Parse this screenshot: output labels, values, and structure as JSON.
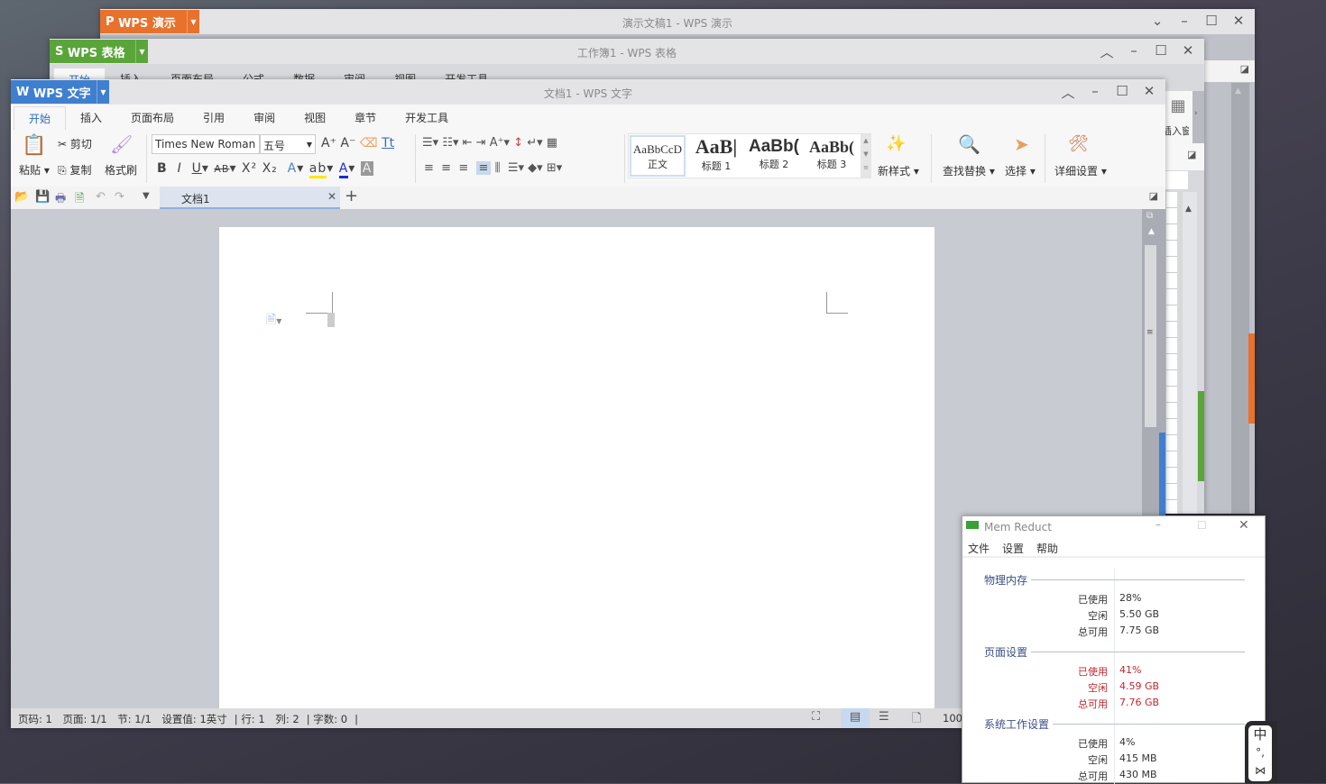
{
  "presentation_window": {
    "app_tab": "WPS 演示",
    "title": "演示文稿1 - WPS 演示",
    "accent": "#e8722c"
  },
  "spreadsheet_window": {
    "app_tab": "WPS 表格",
    "title": "工作簿1 - WPS 表格",
    "accent": "#5aa53a",
    "tabs": [
      "开始",
      "插入",
      "页面布局",
      "公式",
      "数据",
      "审阅",
      "视图",
      "开发工具"
    ],
    "pane_label": "插入窗格"
  },
  "writer_window": {
    "app_tab": "WPS 文字",
    "title": "文档1 - WPS 文字",
    "accent": "#3f7fd0",
    "tabs": [
      "开始",
      "插入",
      "页面布局",
      "引用",
      "审阅",
      "视图",
      "章节",
      "开发工具"
    ],
    "ribbon": {
      "paste": "粘贴",
      "cut": "剪切",
      "copy": "复制",
      "format_painter": "格式刷",
      "font_name": "Times New Roman",
      "font_size": "五号",
      "styles": [
        {
          "preview": "AaBbCcD",
          "label": "正文"
        },
        {
          "preview": "AaB|",
          "label": "标题 1"
        },
        {
          "preview": "AaBb(",
          "label": "标题 2"
        },
        {
          "preview": "AaBb(",
          "label": "标题 3"
        }
      ],
      "new_style": "新样式",
      "find_replace": "查找替换",
      "select": "选择",
      "detail_settings": "详细设置"
    },
    "doc_tab": "文档1",
    "status": {
      "page_no": "页码: 1",
      "pages": "页面: 1/1",
      "section": "节: 1/1",
      "setting": "设置值: 1英寸",
      "row": "行: 1",
      "col": "列: 2",
      "words": "字数: 0",
      "zoom": "100"
    }
  },
  "mem_reduct": {
    "title": "Mem Reduct",
    "menu": [
      "文件",
      "设置",
      "帮助"
    ],
    "sections": [
      {
        "name": "物理内存",
        "warn": false,
        "rows": [
          [
            "已使用",
            "28%"
          ],
          [
            "空闲",
            "5.50 GB"
          ],
          [
            "总可用",
            "7.75 GB"
          ]
        ]
      },
      {
        "name": "页面设置",
        "warn": true,
        "rows": [
          [
            "已使用",
            "41%"
          ],
          [
            "空闲",
            "4.59 GB"
          ],
          [
            "总可用",
            "7.76 GB"
          ]
        ]
      },
      {
        "name": "系统工作设置",
        "warn": false,
        "rows": [
          [
            "已使用",
            "4%"
          ],
          [
            "空闲",
            "415 MB"
          ],
          [
            "总可用",
            "430 MB"
          ]
        ]
      }
    ],
    "warn_color": "#c0282e"
  },
  "ime": {
    "mode": "中",
    "punct": "°,"
  }
}
